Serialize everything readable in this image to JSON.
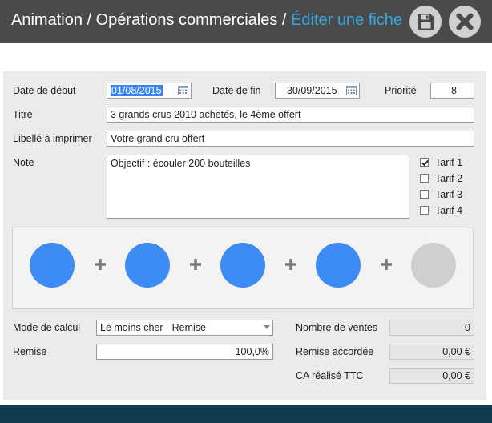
{
  "header": {
    "crumb_1": "Animation",
    "separator_1": " / ",
    "crumb_2": "Opérations commerciales",
    "separator_2": " / ",
    "current": "Éditer une fiche",
    "save_icon": "floppy-disk-icon",
    "close_icon": "close-x-icon"
  },
  "form": {
    "start_date_label": "Date de début",
    "start_date_value": "01/08/2015",
    "end_date_label": "Date de fin",
    "end_date_value": "30/09/2015",
    "priority_label": "Priorité",
    "priority_value": "8",
    "title_label": "Titre",
    "title_value": "3 grands crus 2010 achetés, le 4ème offert",
    "print_label_label": "Libellé à imprimer",
    "print_label_value": "Votre grand cru offert",
    "note_label": "Note",
    "note_value": "Objectif : écouler 200 bouteilles",
    "tariffs": [
      {
        "label": "Tarif 1",
        "checked": true
      },
      {
        "label": "Tarif 2",
        "checked": false
      },
      {
        "label": "Tarif 3",
        "checked": false
      },
      {
        "label": "Tarif 4",
        "checked": false
      }
    ]
  },
  "combination": {
    "slots": [
      "filled",
      "filled",
      "filled",
      "filled",
      "empty"
    ],
    "filled_color": "#3d8bf5",
    "empty_color": "#cfcfcf",
    "operator_icon": "plus-icon"
  },
  "calc": {
    "mode_label": "Mode de calcul",
    "mode_value": "Le moins cher - Remise",
    "discount_label": "Remise",
    "discount_value": "100,0%",
    "sales_count_label": "Nombre de ventes",
    "sales_count_value": "0",
    "granted_discount_label": "Remise accordée",
    "granted_discount_value": "0,00 €",
    "revenue_label": "CA réalisé TTC",
    "revenue_value": "0,00 €"
  },
  "colors": {
    "header_bg": "#4a4a4a",
    "accent": "#35a8e0",
    "footer_bg": "#0f3b4d"
  }
}
